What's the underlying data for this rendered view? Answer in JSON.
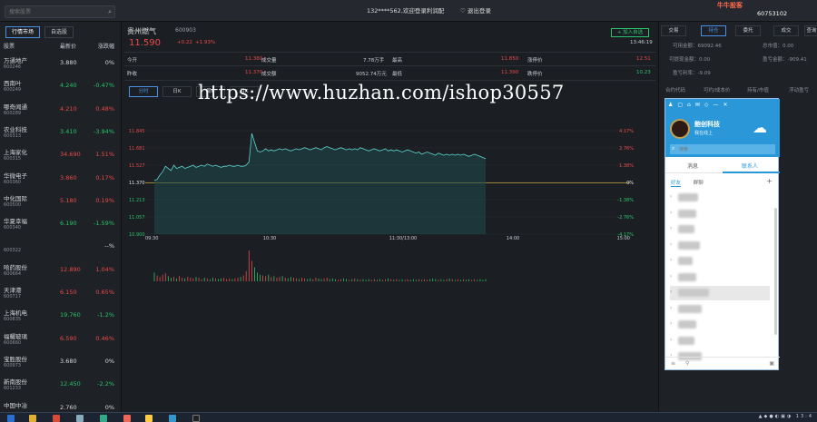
{
  "top": {
    "search_placeholder": "搜索股票",
    "welcome": "132****562,欢迎登录利润配",
    "logout": "退出登录",
    "brand": "牛牛股客",
    "account": "60753102"
  },
  "left": {
    "tabs": [
      "行情市场",
      "自选股"
    ],
    "headers": [
      "股票",
      "最新价",
      "涨跌幅"
    ],
    "stocks": [
      {
        "name": "万通地产",
        "code": "600246",
        "price": "3.880",
        "change": "0%",
        "cls": "white"
      },
      {
        "name": "西南叶",
        "code": "600249",
        "price": "4.240",
        "change": "-0.47%",
        "cls": "green"
      },
      {
        "name": "哪奇闻通",
        "code": "600289",
        "price": "4.210",
        "change": "0.48%",
        "cls": "red"
      },
      {
        "name": "农业科技",
        "code": "600313",
        "price": "3.410",
        "change": "-3.94%",
        "cls": "green"
      },
      {
        "name": "上海家化",
        "code": "600315",
        "price": "34.690",
        "change": "1.51%",
        "cls": "red"
      },
      {
        "name": "华微电子",
        "code": "600360",
        "price": "3.860",
        "change": "0.17%",
        "cls": "red"
      },
      {
        "name": "中化国际",
        "code": "600500",
        "price": "5.180",
        "change": "0.19%",
        "cls": "red"
      },
      {
        "name": "华夏幸福",
        "code": "600340",
        "price": "6.190",
        "change": "-1.59%",
        "cls": "green"
      },
      {
        "name": "",
        "code": "600322",
        "price": "",
        "change": "--%",
        "cls": "white"
      },
      {
        "name": "哈药股份",
        "code": "600664",
        "price": "12.890",
        "change": "1.04%",
        "cls": "red"
      },
      {
        "name": "天津港",
        "code": "600717",
        "price": "6.150",
        "change": "0.65%",
        "cls": "red"
      },
      {
        "name": "上海机电",
        "code": "600835",
        "price": "19.760",
        "change": "-1.2%",
        "cls": "green"
      },
      {
        "name": "福耀玻璃",
        "code": "600660",
        "price": "6.590",
        "change": "0.46%",
        "cls": "red"
      },
      {
        "name": "宝胜股份",
        "code": "600973",
        "price": "3.680",
        "change": "0%",
        "cls": "white"
      },
      {
        "name": "新南股份",
        "code": "601233",
        "price": "12.450",
        "change": "-2.2%",
        "cls": "green"
      },
      {
        "name": "中国中冶",
        "code": "",
        "price": "2.760",
        "change": "0%",
        "cls": "white"
      }
    ]
  },
  "stock": {
    "name": "贵州燃气",
    "code": "600903",
    "price": "11.590",
    "change_abs": "+0.22",
    "change_pct": "+1.93%",
    "add_button": "+ 加入自选",
    "time": "13:46:19",
    "quote_rows": [
      [
        [
          "今开",
          "11.380"
        ],
        [
          "成交量",
          "7.78万手"
        ],
        [
          "最高",
          "11.850"
        ],
        [
          "涨停价",
          "12.51"
        ]
      ],
      [
        [
          "昨收",
          "11.370"
        ],
        [
          "成交额",
          "9052.74万元"
        ],
        [
          "最低",
          "11.390"
        ],
        [
          "跌停价",
          "10.23"
        ]
      ]
    ]
  },
  "chart_tabs": [
    "分时",
    "日K",
    "周K",
    "月K"
  ],
  "watermark": "https://www.huzhan.com/ishop30557",
  "chart_data": {
    "type": "line",
    "title": "",
    "x_ticks": [
      "09:30",
      "10:30",
      "11:30/13:00",
      "14:00",
      "15:00"
    ],
    "y_ticks_left": [
      "11.845",
      "11.681",
      "11.527",
      "11.370",
      "11.213",
      "11.057",
      "10.900"
    ],
    "y_ticks_right": [
      "4.17%",
      "2.76%",
      "1.38%",
      "0%",
      "-1.38%",
      "-2.76%",
      "-4.17%"
    ],
    "ylim": [
      10.9,
      11.845
    ],
    "prev_close": 11.37,
    "price_series": [
      11.39,
      11.4,
      11.44,
      11.47,
      11.52,
      11.5,
      11.48,
      11.53,
      11.5,
      11.51,
      11.52,
      11.5,
      11.51,
      11.52,
      11.53,
      11.51,
      11.52,
      11.53,
      11.52,
      11.54,
      11.53,
      11.52,
      11.53,
      11.52,
      11.51,
      11.52,
      11.52,
      11.53,
      11.52,
      11.52,
      11.53,
      11.52,
      11.52,
      11.53,
      11.56,
      11.82,
      11.74,
      11.66,
      11.65,
      11.66,
      11.68,
      11.66,
      11.67,
      11.66,
      11.67,
      11.68,
      11.67,
      11.68,
      11.67,
      11.66,
      11.67,
      11.68,
      11.67,
      11.68,
      11.69,
      11.68,
      11.67,
      11.68,
      11.69,
      11.68,
      11.67,
      11.69,
      11.7,
      11.69,
      11.68,
      11.67,
      11.68,
      11.69,
      11.68,
      11.67,
      11.68,
      11.67,
      11.68,
      11.67,
      11.69,
      11.68,
      11.67,
      11.66,
      11.67,
      11.68,
      11.67,
      11.66,
      11.67,
      11.68,
      11.66,
      11.67,
      11.66,
      11.67,
      11.66,
      11.65,
      11.66,
      11.67,
      11.66,
      11.65,
      11.64,
      11.65,
      11.63,
      11.64,
      11.65,
      11.64,
      11.63,
      11.62,
      11.64,
      11.63,
      11.62,
      11.63,
      11.62,
      11.63,
      11.62,
      11.63,
      11.62,
      11.63,
      11.62,
      11.61,
      11.62,
      11.63,
      11.62,
      11.61,
      11.6,
      11.59
    ],
    "volume_series": [
      1.2,
      0.8,
      0.6,
      0.9,
      1.1,
      0.7,
      0.5,
      0.6,
      0.4,
      0.7,
      0.5,
      0.4,
      0.6,
      0.5,
      0.4,
      0.6,
      0.5,
      0.3,
      0.5,
      0.4,
      0.3,
      0.5,
      0.4,
      0.3,
      0.4,
      0.5,
      0.3,
      0.4,
      0.3,
      0.4,
      0.5,
      0.6,
      0.8,
      1.4,
      4.2,
      2.8,
      1.9,
      1.2,
      0.9,
      0.8,
      0.7,
      0.9,
      0.6,
      0.7,
      0.5,
      0.6,
      0.7,
      0.5,
      0.4,
      0.6,
      0.5,
      0.4,
      0.3,
      0.5,
      0.4,
      0.3,
      0.4,
      0.3,
      0.5,
      0.4,
      0.3,
      0.4,
      0.5,
      0.3,
      0.4,
      0.3,
      0.2,
      0.3,
      0.4,
      0.3,
      0.2,
      0.3,
      0.4,
      0.3,
      0.2,
      0.3,
      0.2,
      0.3,
      0.2,
      0.3,
      0.2,
      0.3,
      0.2,
      0.3,
      0.4,
      0.3,
      0.2,
      0.3,
      0.2,
      0.3,
      0.2,
      0.3,
      0.2,
      0.3,
      0.2,
      0.3,
      0.2,
      0.3,
      0.2,
      0.3,
      0.4,
      0.3,
      0.2,
      0.3,
      0.2,
      0.3,
      0.4,
      0.3,
      0.2,
      0.3,
      0.2,
      0.3,
      0.2,
      0.3,
      0.2,
      0.3,
      0.2,
      0.3,
      0.2,
      0.3
    ],
    "line_color": "#e6e6e6",
    "avg_color": "#e6c13a",
    "up_color": "#e94b4b",
    "down_color": "#29c46b"
  },
  "right": {
    "tabs": [
      "交易",
      "持仓",
      "委托",
      "成交",
      "查询"
    ],
    "info": [
      [
        "可用金额：69092.46",
        "总市值：0.00"
      ],
      [
        "可提现金额：0.00",
        "盈亏金额：-909.41"
      ],
      [
        "盈亏利率：-9.09",
        ""
      ]
    ],
    "list_headers": [
      "合约代码",
      "可约/成本价",
      "持有/市值",
      "浮动盈亏"
    ]
  },
  "qq": {
    "name": "鲍创科技",
    "status": "我在线上",
    "search_placeholder": "搜索",
    "tabs": [
      "消息",
      "联系人"
    ],
    "subtabs": [
      "好友",
      "群聊"
    ],
    "plus": "+",
    "groups": 11
  },
  "taskbar": {
    "clock": "13:4"
  }
}
